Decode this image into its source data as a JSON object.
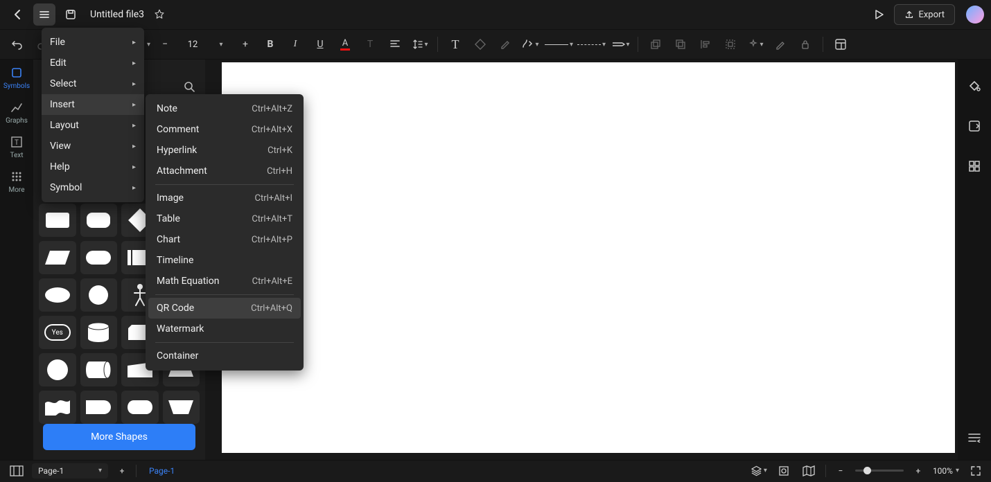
{
  "topbar": {
    "file_title": "Untitled file3",
    "export_label": "Export"
  },
  "toolbar": {
    "font_size": "12"
  },
  "rail": {
    "items": [
      {
        "name": "symbols",
        "label": "Symbols",
        "active": true
      },
      {
        "name": "graphs",
        "label": "Graphs"
      },
      {
        "name": "text",
        "label": "Text"
      },
      {
        "name": "more",
        "label": "More"
      }
    ]
  },
  "shapes_panel": {
    "more_shapes_label": "More Shapes",
    "yes_label": "Yes"
  },
  "main_menu": {
    "items": [
      {
        "label": "File"
      },
      {
        "label": "Edit"
      },
      {
        "label": "Select"
      },
      {
        "label": "Insert",
        "hover": true
      },
      {
        "label": "Layout"
      },
      {
        "label": "View"
      },
      {
        "label": "Help"
      },
      {
        "label": "Symbol"
      }
    ]
  },
  "insert_submenu": {
    "groups": [
      [
        {
          "label": "Note",
          "shortcut": "Ctrl+Alt+Z"
        },
        {
          "label": "Comment",
          "shortcut": "Ctrl+Alt+X"
        },
        {
          "label": "Hyperlink",
          "shortcut": "Ctrl+K"
        },
        {
          "label": "Attachment",
          "shortcut": "Ctrl+H"
        }
      ],
      [
        {
          "label": "Image",
          "shortcut": "Ctrl+Alt+I"
        },
        {
          "label": "Table",
          "shortcut": "Ctrl+Alt+T"
        },
        {
          "label": "Chart",
          "shortcut": "Ctrl+Alt+P"
        },
        {
          "label": "Timeline",
          "shortcut": ""
        },
        {
          "label": "Math Equation",
          "shortcut": "Ctrl+Alt+E"
        }
      ],
      [
        {
          "label": "QR Code",
          "shortcut": "Ctrl+Alt+Q",
          "hover": true
        },
        {
          "label": "Watermark",
          "shortcut": ""
        }
      ],
      [
        {
          "label": "Container",
          "shortcut": ""
        }
      ]
    ]
  },
  "bottombar": {
    "page_select": "Page-1",
    "page_tab": "Page-1",
    "zoom_label": "100%"
  }
}
